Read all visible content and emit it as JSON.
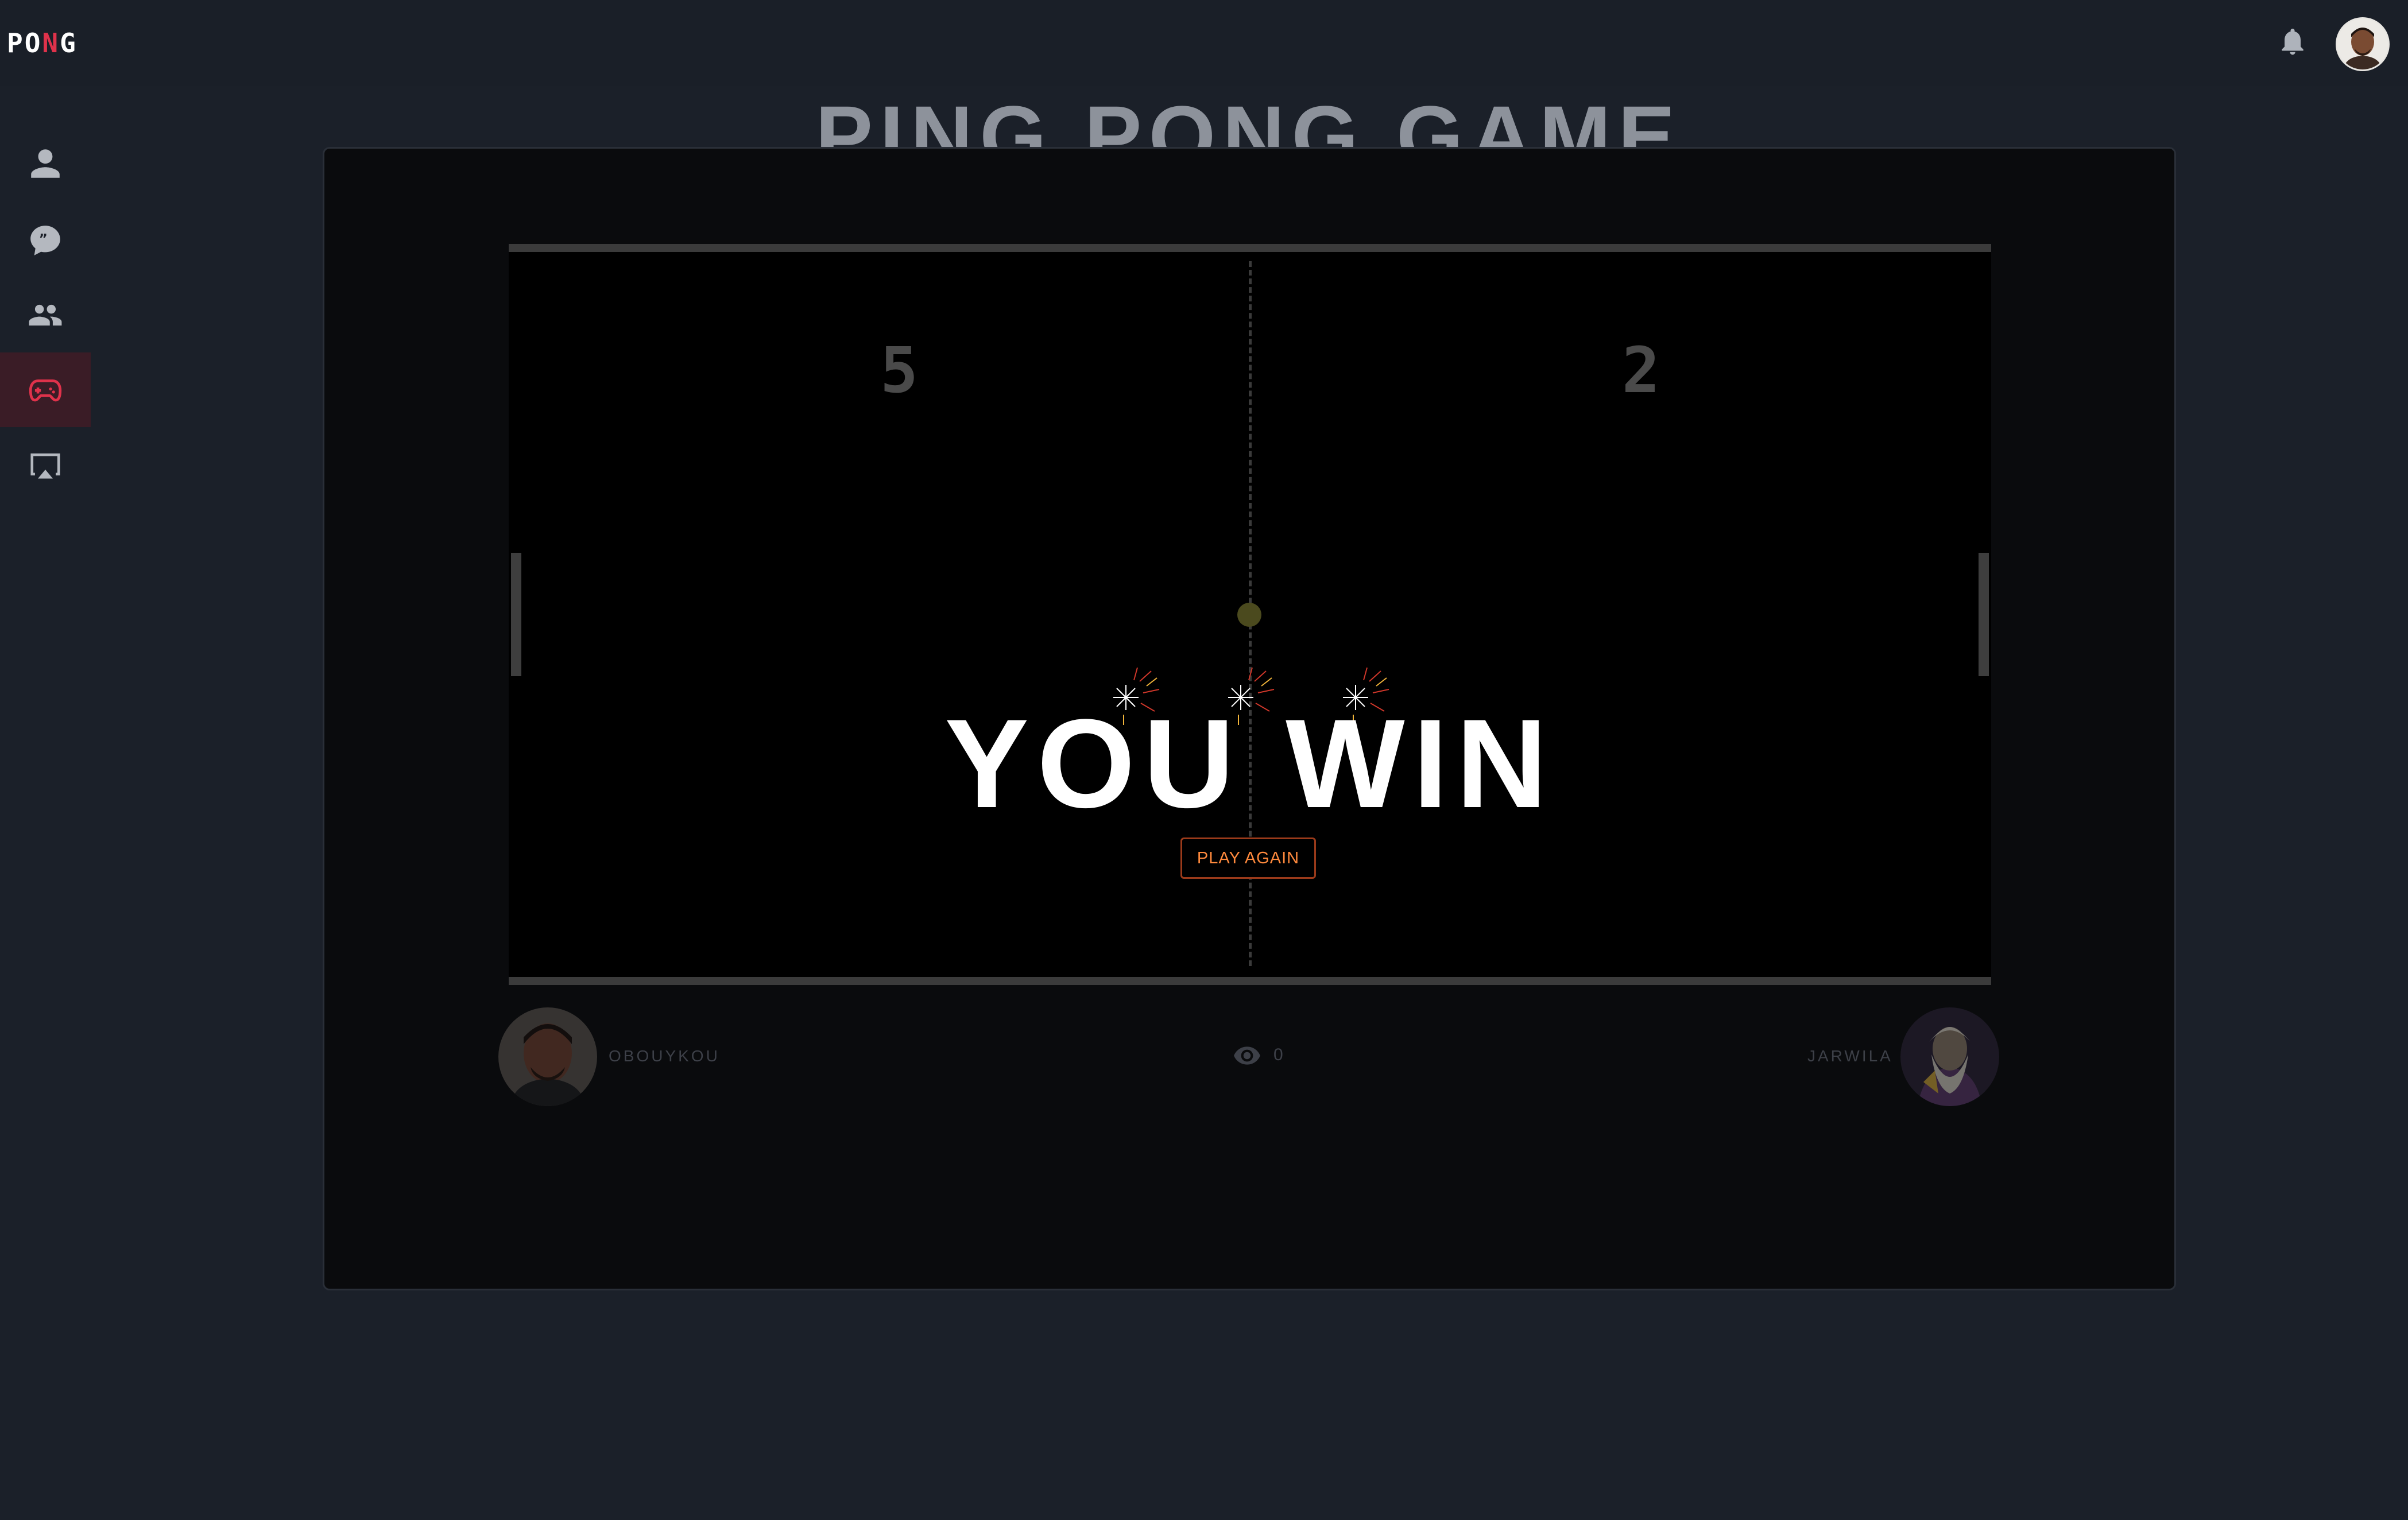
{
  "app": {
    "logo_text_1": "PO",
    "logo_text_accent": "N",
    "logo_text_2": "G"
  },
  "header": {
    "notifications_icon": "bell-icon",
    "avatar_icon": "user-avatar"
  },
  "sidebar": {
    "items": [
      {
        "name": "profile",
        "icon": "user-icon",
        "active": false
      },
      {
        "name": "chat",
        "icon": "chat-bubble-icon",
        "active": false
      },
      {
        "name": "friends",
        "icon": "users-icon",
        "active": false
      },
      {
        "name": "game",
        "icon": "gamepad-icon",
        "active": true
      },
      {
        "name": "stream",
        "icon": "airplay-icon",
        "active": false
      }
    ]
  },
  "page": {
    "title": "PING PONG GAME"
  },
  "game": {
    "score_left": "5",
    "score_right": "2",
    "result_text": "YOU WIN",
    "play_again_label": "PLAY AGAIN",
    "viewers_count": "0",
    "player_left": "OBOUYKOU",
    "player_right": "JARWILA"
  },
  "colors": {
    "background": "#1b2029",
    "panel": "#0a0b0d",
    "accent_red": "#e0324b",
    "button_text": "#ff8a3d",
    "button_border": "#9b3a1a"
  }
}
